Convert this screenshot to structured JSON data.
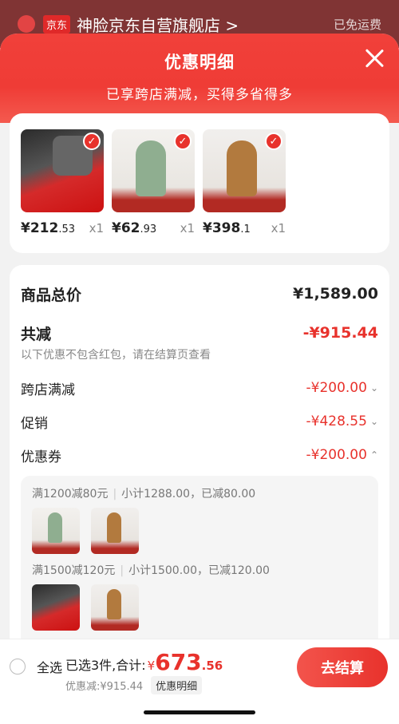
{
  "background": {
    "jd_tag": "京东",
    "store_name": "神脸京东自营旗舰店 >",
    "right_text": "已免运费"
  },
  "sheet": {
    "title": "优惠明细",
    "subtitle": "已享跨店满减，买得多省得多"
  },
  "products": [
    {
      "price_int": "¥212",
      "price_dec": ".53",
      "qty": "x1"
    },
    {
      "price_int": "¥62",
      "price_dec": ".93",
      "qty": "x1"
    },
    {
      "price_int": "¥398",
      "price_dec": ".1",
      "qty": "x1"
    }
  ],
  "summary": {
    "total_label": "商品总价",
    "total_value": "¥1,589.00",
    "minus_label": "共减",
    "minus_value": "-¥915.44",
    "note": "以下优惠不包含红包，请在结算页查看",
    "items": [
      {
        "label": "跨店满减",
        "value": "-¥200.00",
        "chev": "⌄"
      },
      {
        "label": "促销",
        "value": "-¥428.55",
        "chev": "⌄"
      },
      {
        "label": "优惠券",
        "value": "-¥200.00",
        "chev": "⌃"
      }
    ]
  },
  "coupons": [
    {
      "rule": "满1200减80元",
      "subtotal": "小计1288.00，已减80.00"
    },
    {
      "rule": "满1500减120元",
      "subtotal": "小计1500.00，已减120.00"
    }
  ],
  "bottom": {
    "select_all": "全选",
    "selected": "已选3件,合计:",
    "amount_symbol": "¥",
    "amount_int": "673",
    "amount_dec": ".56",
    "discount": "优惠减:¥915.44",
    "detail_tag": "优惠明细",
    "checkout": "去结算"
  },
  "colors": {
    "accent": "#e8322c",
    "header": "#ef3c36"
  }
}
